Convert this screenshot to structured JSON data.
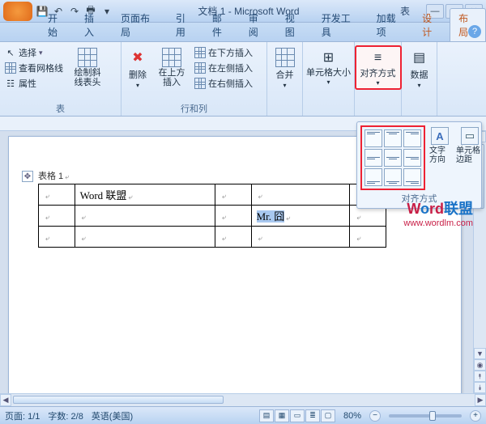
{
  "title": "文档 1 - Microsoft Word",
  "title_context": "表",
  "tabs": {
    "items": [
      "开始",
      "插入",
      "页面布局",
      "引用",
      "邮件",
      "审阅",
      "视图",
      "开发工具",
      "加载项"
    ],
    "context": [
      "设计",
      "布局"
    ],
    "active": "布局"
  },
  "ribbon": {
    "group_table": {
      "label": "表",
      "select": "选择",
      "gridlines": "查看网格线",
      "properties": "属性",
      "draw": "绘制斜线表头"
    },
    "group_rowcol": {
      "label": "行和列",
      "delete": "删除",
      "insert_above": "在上方插入",
      "insert_below": "在下方插入",
      "insert_left": "在左侧插入",
      "insert_right": "在右侧插入"
    },
    "group_merge": {
      "label": "合并",
      "merge": "合并"
    },
    "group_cellsize": {
      "label": "单元格大小",
      "text": "单元格大小"
    },
    "group_align": {
      "label": "对齐方式",
      "text": "对齐方式"
    },
    "group_data": {
      "label": "数据",
      "text": "数据"
    }
  },
  "align_popup": {
    "label": "对齐方式",
    "text_dir": "文字方向",
    "cell_margin": "单元格边距"
  },
  "document": {
    "table_caption": "表格 1",
    "cells": {
      "r0c1": "Word 联盟",
      "r1c3": "Mr. 囧"
    }
  },
  "watermark": {
    "line1a": "W",
    "line1b": "o",
    "line1c": "rd",
    "line1d": "联盟",
    "line2": "www.wordlm.com"
  },
  "status": {
    "page": "页面: 1/1",
    "words": "字数: 2/8",
    "lang": "英语(美国)",
    "zoom": "80%"
  }
}
